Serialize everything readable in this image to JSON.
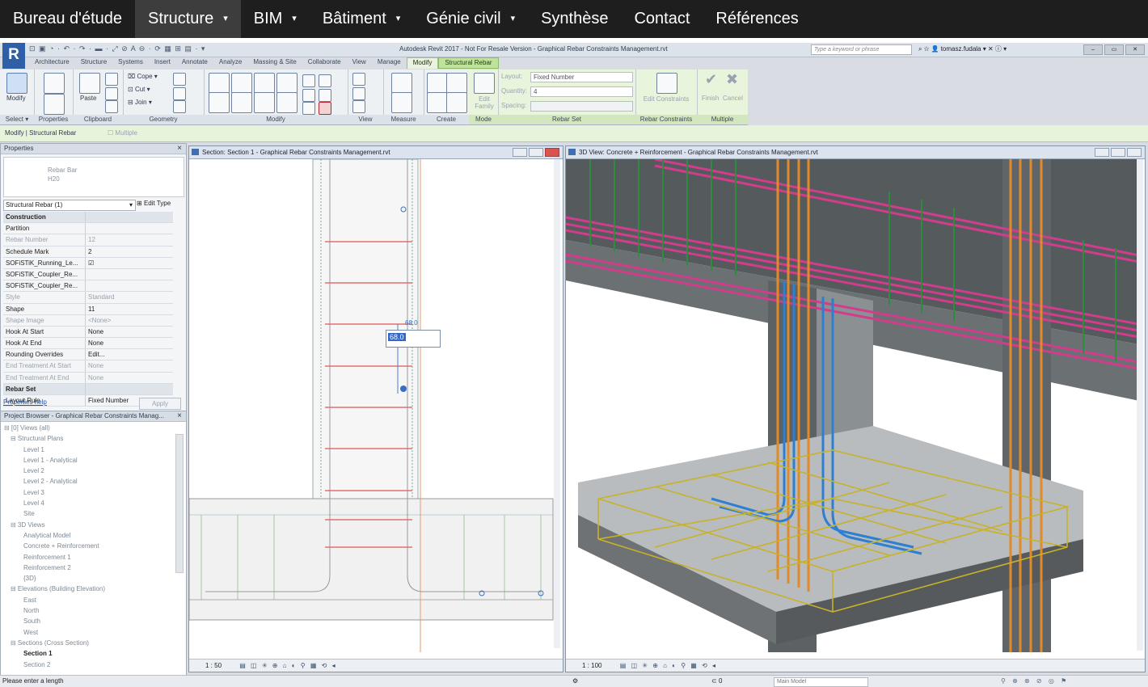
{
  "nav": {
    "items": [
      {
        "label": "Bureau d'étude",
        "dropdown": false,
        "active": false
      },
      {
        "label": "Structure",
        "dropdown": true,
        "active": true
      },
      {
        "label": "BIM",
        "dropdown": true,
        "active": false
      },
      {
        "label": "Bâtiment",
        "dropdown": true,
        "active": false
      },
      {
        "label": "Génie civil",
        "dropdown": true,
        "active": false
      },
      {
        "label": "Synthèse",
        "dropdown": false,
        "active": false
      },
      {
        "label": "Contact",
        "dropdown": false,
        "active": false
      },
      {
        "label": "Références",
        "dropdown": false,
        "active": false
      }
    ],
    "caret": "▾"
  },
  "revit": {
    "logo": "R",
    "window_title": "Autodesk Revit 2017 - Not For Resale Version -   Graphical Rebar Constraints Management.rvt",
    "search_placeholder": "Type a keyword or phrase",
    "user": "tomasz.fudala",
    "tabs": [
      "Architecture",
      "Structure",
      "Systems",
      "Insert",
      "Annotate",
      "Analyze",
      "Massing & Site",
      "Collaborate",
      "View",
      "Manage",
      "Modify",
      "Structural Rebar"
    ],
    "ribbon": {
      "modify_label": "Modify",
      "paste_label": "Paste",
      "cope_label": "Cope",
      "cut_label": "Cut",
      "join_label": "Join",
      "edit_family_label": "Edit Family",
      "layout_label": "Layout:",
      "layout_value": "Fixed Number",
      "quantity_label": "Quantity:",
      "quantity_value": "4",
      "spacing_label": "Spacing:",
      "edit_constraints_label": "Edit Constraints",
      "finish_label": "Finish",
      "cancel_label": "Cancel",
      "panels": [
        "Select ▾",
        "Properties",
        "Clipboard",
        "Geometry",
        "Modify",
        "View",
        "Measure",
        "Create",
        "Mode",
        "Rebar Set",
        "Rebar Constraints",
        "Multiple"
      ]
    },
    "options_bar": {
      "context": "Modify | Structural Rebar",
      "multiple_label": "Multiple"
    },
    "properties": {
      "title": "Properties",
      "type_name": "Rebar Bar",
      "type_size": "H20",
      "selector": "Structural Rebar (1)",
      "edit_type": "Edit Type",
      "rows": [
        {
          "k": "Construction",
          "v": "",
          "section": true
        },
        {
          "k": "Partition",
          "v": ""
        },
        {
          "k": "Rebar Number",
          "v": "12",
          "dim": true
        },
        {
          "k": "Schedule Mark",
          "v": "2"
        },
        {
          "k": "SOFiSTiK_Running_Le...",
          "v": "☑"
        },
        {
          "k": "SOFiSTiK_Coupler_Re...",
          "v": ""
        },
        {
          "k": "SOFiSTiK_Coupler_Re...",
          "v": ""
        },
        {
          "k": "Style",
          "v": "Standard",
          "dim": true
        },
        {
          "k": "Shape",
          "v": "11"
        },
        {
          "k": "Shape Image",
          "v": "<None>",
          "dim": true
        },
        {
          "k": "Hook At Start",
          "v": "None"
        },
        {
          "k": "Hook At End",
          "v": "None"
        },
        {
          "k": "Rounding Overrides",
          "v": "Edit..."
        },
        {
          "k": "End Treatment At Start",
          "v": "None",
          "dim": true
        },
        {
          "k": "End Treatment At End",
          "v": "None",
          "dim": true
        },
        {
          "k": "Rebar Set",
          "v": "",
          "section": true
        },
        {
          "k": "Layout Rule",
          "v": "Fixed Number"
        }
      ],
      "help": "Properties help",
      "apply": "Apply"
    },
    "browser": {
      "title": "Project Browser - Graphical Rebar Constraints Manag...",
      "items": [
        {
          "label": "⊟ [0] Views (all)",
          "indent": 0,
          "current": false
        },
        {
          "label": "⊟ Structural Plans",
          "indent": 1,
          "current": false
        },
        {
          "label": "Level 1",
          "indent": 3,
          "current": false
        },
        {
          "label": "Level 1 - Analytical",
          "indent": 3,
          "current": false
        },
        {
          "label": "Level 2",
          "indent": 3,
          "current": false
        },
        {
          "label": "Level 2 - Analytical",
          "indent": 3,
          "current": false
        },
        {
          "label": "Level 3",
          "indent": 3,
          "current": false
        },
        {
          "label": "Level 4",
          "indent": 3,
          "current": false
        },
        {
          "label": "Site",
          "indent": 3,
          "current": false
        },
        {
          "label": "⊟ 3D Views",
          "indent": 1,
          "current": false
        },
        {
          "label": "Analytical Model",
          "indent": 3,
          "current": false
        },
        {
          "label": "Concrete + Reinforcement",
          "indent": 3,
          "current": false
        },
        {
          "label": "Reinforcement 1",
          "indent": 3,
          "current": false
        },
        {
          "label": "Reinforcement 2",
          "indent": 3,
          "current": false
        },
        {
          "label": "{3D}",
          "indent": 3,
          "current": false
        },
        {
          "label": "⊟ Elevations (Building Elevation)",
          "indent": 1,
          "current": false
        },
        {
          "label": "East",
          "indent": 3,
          "current": false
        },
        {
          "label": "North",
          "indent": 3,
          "current": false
        },
        {
          "label": "South",
          "indent": 3,
          "current": false
        },
        {
          "label": "West",
          "indent": 3,
          "current": false
        },
        {
          "label": "⊟ Sections (Cross Section)",
          "indent": 1,
          "current": false
        },
        {
          "label": "Section 1",
          "indent": 3,
          "current": true
        },
        {
          "label": "Section 2",
          "indent": 3,
          "current": false
        }
      ]
    },
    "section_view": {
      "title": "Section: Section 1 - Graphical Rebar Constraints Management.rvt",
      "scale": "1 : 50",
      "dimension": "68.0",
      "edit_value": "68.0"
    },
    "view3d": {
      "title": "3D View: Concrete + Reinforcement - Graphical Rebar Constraints Management.rvt",
      "scale": "1 : 100"
    },
    "status": {
      "message": "Please enter a length",
      "model": "Main Model",
      "zero": "0"
    }
  }
}
